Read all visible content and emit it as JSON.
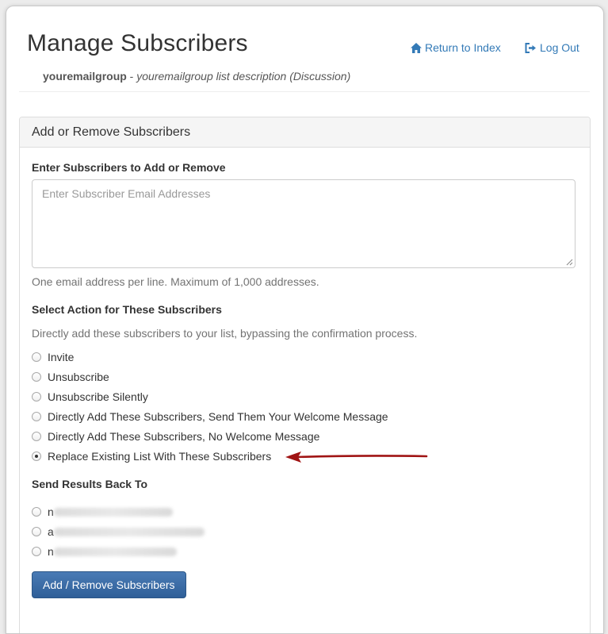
{
  "header": {
    "title": "Manage Subscribers",
    "group_name": "youremailgroup",
    "separator": " - ",
    "group_description": "youremailgroup list description (Discussion)",
    "return_link": "Return to Index",
    "logout_link": "Log Out"
  },
  "panel": {
    "heading": "Add or Remove Subscribers",
    "enter_label": "Enter Subscribers to Add or Remove",
    "textarea_placeholder": "Enter Subscriber Email Addresses",
    "textarea_value": "",
    "help_text": "One email address per line. Maximum of 1,000 addresses.",
    "action_label": "Select Action for These Subscribers",
    "action_description": "Directly add these subscribers to your list, bypassing the confirmation process.",
    "actions": [
      {
        "label": "Invite",
        "checked": false
      },
      {
        "label": "Unsubscribe",
        "checked": false
      },
      {
        "label": "Unsubscribe Silently",
        "checked": false
      },
      {
        "label": "Directly Add These Subscribers, Send Them Your Welcome Message",
        "checked": false
      },
      {
        "label": "Directly Add These Subscribers, No Welcome Message",
        "checked": false
      },
      {
        "label": "Replace Existing List With These Subscribers",
        "checked": true
      }
    ],
    "results_label": "Send Results Back To",
    "results_options": [
      {
        "initial": "n",
        "checked": false
      },
      {
        "initial": "a",
        "checked": false
      },
      {
        "initial": "n",
        "checked": false
      }
    ],
    "submit_button": "Add / Remove Subscribers"
  },
  "colors": {
    "link": "#337ab7",
    "button": "#3a6aa6",
    "annotation_arrow": "#a01414"
  },
  "icons": {
    "return_link": "home-icon",
    "logout_link": "log-out-icon"
  }
}
